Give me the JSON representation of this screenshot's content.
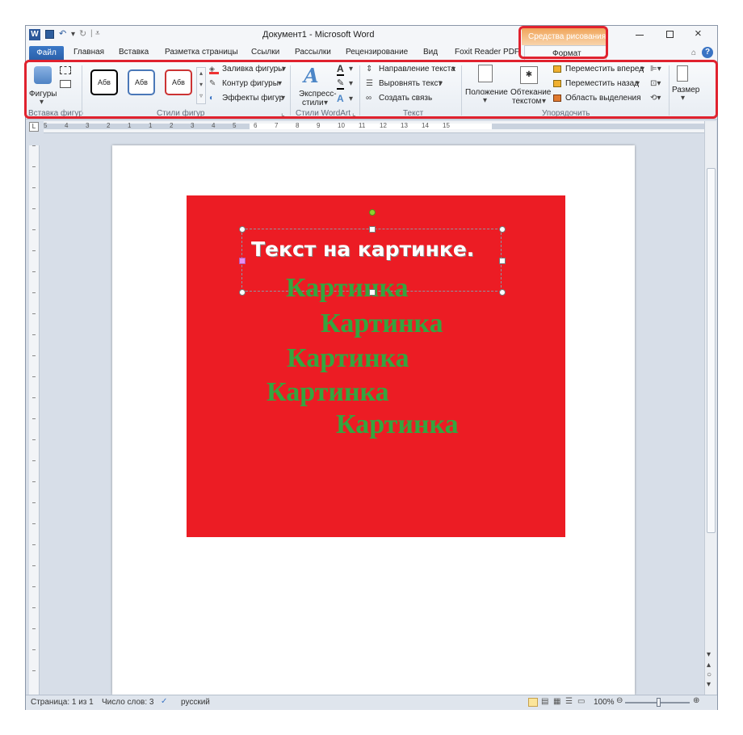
{
  "window": {
    "title": "Документ1 - Microsoft Word",
    "contextual_group": "Средства рисования",
    "contextual_tab": "Формат"
  },
  "tabs": [
    "Файл",
    "Главная",
    "Вставка",
    "Разметка страницы",
    "Ссылки",
    "Рассылки",
    "Рецензирование",
    "Вид",
    "Foxit Reader PDF"
  ],
  "ribbon": {
    "insert_shapes": {
      "shapes_label": "Фигуры",
      "group_label": "Вставка фигур"
    },
    "shape_styles": {
      "preset_label": "Абв",
      "fill": "Заливка фигуры",
      "outline": "Контур фигуры",
      "effects": "Эффекты фигур",
      "group_label": "Стили фигур"
    },
    "wordart": {
      "express_line1": "Экспресс-",
      "express_line2": "стили",
      "group_label": "Стили WordArt"
    },
    "text": {
      "direction": "Направление текста",
      "align": "Выровнять текст",
      "link": "Создать связь",
      "group_label": "Текст"
    },
    "arrange": {
      "position": "Положение",
      "wrap_line1": "Обтекание",
      "wrap_line2": "текстом",
      "bring_forward": "Переместить вперед",
      "send_backward": "Переместить назад",
      "selection_pane": "Область выделения",
      "group_label": "Упорядочить"
    },
    "size": {
      "label": "Размер"
    }
  },
  "ruler_numbers": [
    "5",
    "4",
    "3",
    "2",
    "1",
    "1",
    "2",
    "3",
    "4",
    "5",
    "6",
    "7",
    "8",
    "9",
    "10",
    "11",
    "12",
    "13",
    "14",
    "15"
  ],
  "document": {
    "overlay_text": "Текст на картинке.",
    "green_words": [
      "Картинка",
      "Картинка",
      "Картинка",
      "Картинка",
      "Картинка"
    ]
  },
  "status": {
    "page": "Страница: 1 из 1",
    "words": "Число слов: 3",
    "language": "русский",
    "zoom": "100%"
  },
  "colors": {
    "accent": "#2a5fa8",
    "picture_red": "#ec1c24",
    "text_green": "#34a53f",
    "highlight": "#e0222e"
  }
}
